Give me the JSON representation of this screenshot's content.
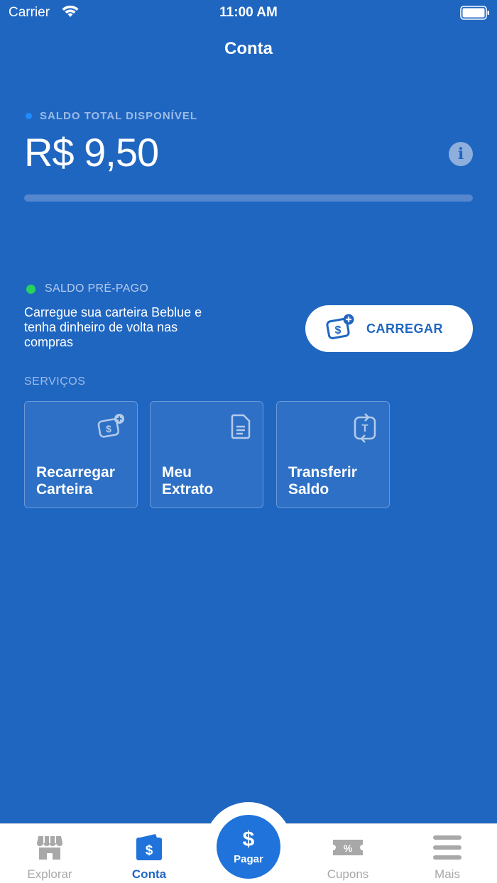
{
  "status_bar": {
    "carrier": "Carrier",
    "time": "11:00 AM",
    "icons": [
      "wifi-icon",
      "battery-icon"
    ]
  },
  "header": {
    "title": "Conta"
  },
  "balance": {
    "label": "SALDO TOTAL DISPONÍVEL",
    "value": "R$ 9,50",
    "progress_fraction": 0,
    "info_icon": "info-icon"
  },
  "prepaid": {
    "label": "SALDO PRÉ-PAGO",
    "description": "Carregue sua carteira Beblue e tenha dinheiro de volta nas compras",
    "button_label": "CARREGAR",
    "button_icon": "wallet-add-icon"
  },
  "services": {
    "label": "SERVIÇOS",
    "items": [
      {
        "title": "Recarregar\nCarteira",
        "icon": "wallet-add-icon"
      },
      {
        "title": "Meu\nExtrato",
        "icon": "document-icon"
      },
      {
        "title": "Transferir\nSaldo",
        "icon": "transfer-icon"
      }
    ]
  },
  "tab_bar": {
    "items": [
      {
        "label": "Explorar",
        "icon": "store-icon",
        "active": false
      },
      {
        "label": "Conta",
        "icon": "wallet-icon",
        "active": true
      },
      {
        "label": "Cupons",
        "icon": "coupon-icon",
        "active": false
      },
      {
        "label": "Mais",
        "icon": "menu-icon",
        "active": false
      }
    ],
    "pay": {
      "symbol": "$",
      "label": "Pagar"
    }
  },
  "colors": {
    "background": "#1f66c1",
    "accent": "#1f73da",
    "prepaid_dot": "#27d15e",
    "balance_dot": "#1d8cff"
  }
}
